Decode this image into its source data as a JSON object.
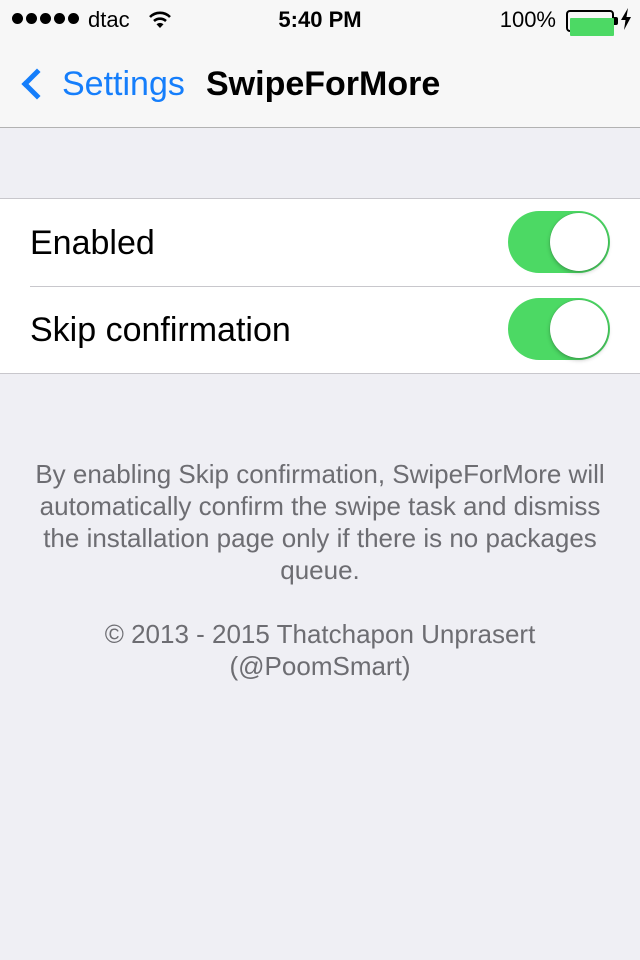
{
  "status_bar": {
    "carrier": "dtac",
    "time": "5:40 PM",
    "battery_percent": "100%",
    "signal_bars": 5,
    "wifi_icon": "wifi-icon",
    "battery_icon": "battery-icon",
    "charging_icon": "charging-bolt-icon"
  },
  "nav": {
    "back_label": "Settings",
    "back_icon": "chevron-left-icon",
    "title": "SwipeForMore"
  },
  "settings": {
    "rows": [
      {
        "label": "Enabled",
        "on": true
      },
      {
        "label": "Skip confirmation",
        "on": true
      }
    ]
  },
  "footer": {
    "description": "By enabling Skip confirmation, SwipeForMore will automatically confirm the swipe task and dismiss the installation page only if there is no packages queue.",
    "copyright": "© 2013 - 2015 Thatchapon Unprasert (@PoomSmart)"
  },
  "colors": {
    "accent": "#157efb",
    "switch_on": "#4cd964",
    "background": "#efeff4",
    "footer_text": "#6d6d72"
  }
}
